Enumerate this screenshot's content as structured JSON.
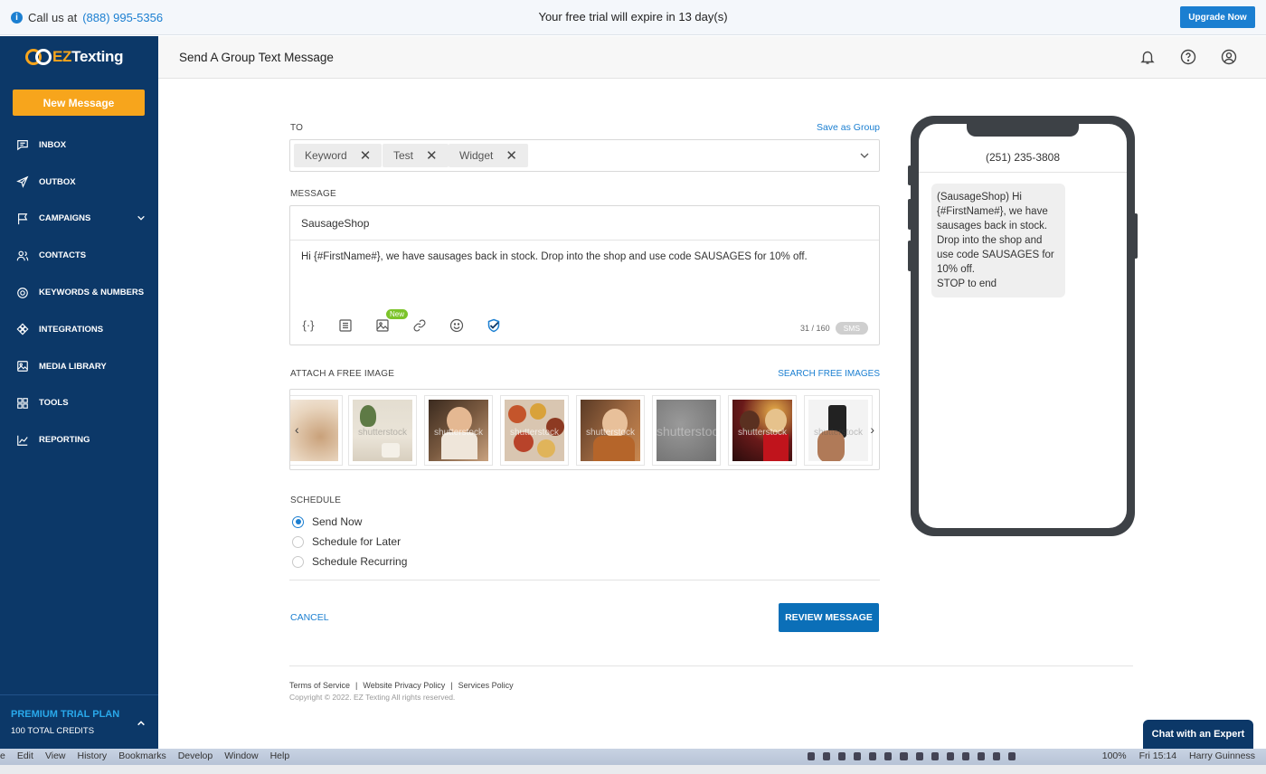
{
  "topbar": {
    "call_prefix": "Call us at",
    "phone": "(888) 995-5356",
    "trial": "Your free trial will expire in 13 day(s)",
    "upgrade": "Upgrade Now"
  },
  "sidebar": {
    "logo_ez": "EZ",
    "logo_texting": "Texting",
    "new_message": "New Message",
    "items": [
      {
        "label": "INBOX",
        "icon": "inbox-icon"
      },
      {
        "label": "OUTBOX",
        "icon": "paper-plane-icon"
      },
      {
        "label": "CAMPAIGNS",
        "icon": "flag-icon"
      },
      {
        "label": "CONTACTS",
        "icon": "people-icon"
      },
      {
        "label": "KEYWORDS & NUMBERS",
        "icon": "target-icon"
      },
      {
        "label": "INTEGRATIONS",
        "icon": "integrations-icon"
      },
      {
        "label": "MEDIA LIBRARY",
        "icon": "image-icon"
      },
      {
        "label": "TOOLS",
        "icon": "grid-icon"
      },
      {
        "label": "REPORTING",
        "icon": "line-chart-icon"
      }
    ],
    "plan_title": "PREMIUM TRIAL PLAN",
    "plan_credits": "100 TOTAL CREDITS"
  },
  "header": {
    "title": "Send A Group Text Message"
  },
  "form": {
    "to_label": "TO",
    "save_group": "Save as Group",
    "chips": [
      "Keyword",
      "Test",
      "Widget"
    ],
    "message_label": "MESSAGE",
    "sender": "SausageShop",
    "body": "Hi {#FirstName#}, we have sausages back in stock. Drop into the shop and use code SAUSAGES for 10% off.",
    "new_badge": "New",
    "counter": "31 / 160",
    "sms_badge": "SMS",
    "attach_label": "ATTACH A FREE IMAGE",
    "search_images": "SEARCH FREE IMAGES",
    "watermark": "shutterstock",
    "schedule_label": "SCHEDULE",
    "schedule_options": [
      "Send Now",
      "Schedule for Later",
      "Schedule Recurring"
    ],
    "cancel": "CANCEL",
    "review": "REVIEW MESSAGE"
  },
  "footer": {
    "links": [
      "Terms of Service",
      "Website Privacy Policy",
      "Services Policy"
    ],
    "separator": "|",
    "copyright": "Copyright © 2022. EZ Texting All rights reserved."
  },
  "phone": {
    "number": "(251) 235-3808",
    "preview": "(SausageShop) Hi {#FirstName#}, we have sausages back in stock. Drop into the shop and use code SAUSAGES for 10% off.\nSTOP to end"
  },
  "chat": "Chat with an Expert",
  "os": {
    "menus": [
      "e",
      "Edit",
      "View",
      "History",
      "Bookmarks",
      "Develop",
      "Window",
      "Help"
    ],
    "battery": "100%",
    "clock": "Fri 15:14",
    "user": "Harry Guinness"
  },
  "colors": {
    "sidebar": "#0c3868",
    "accent_orange": "#f7a51c",
    "link_blue": "#1b7fd1"
  }
}
